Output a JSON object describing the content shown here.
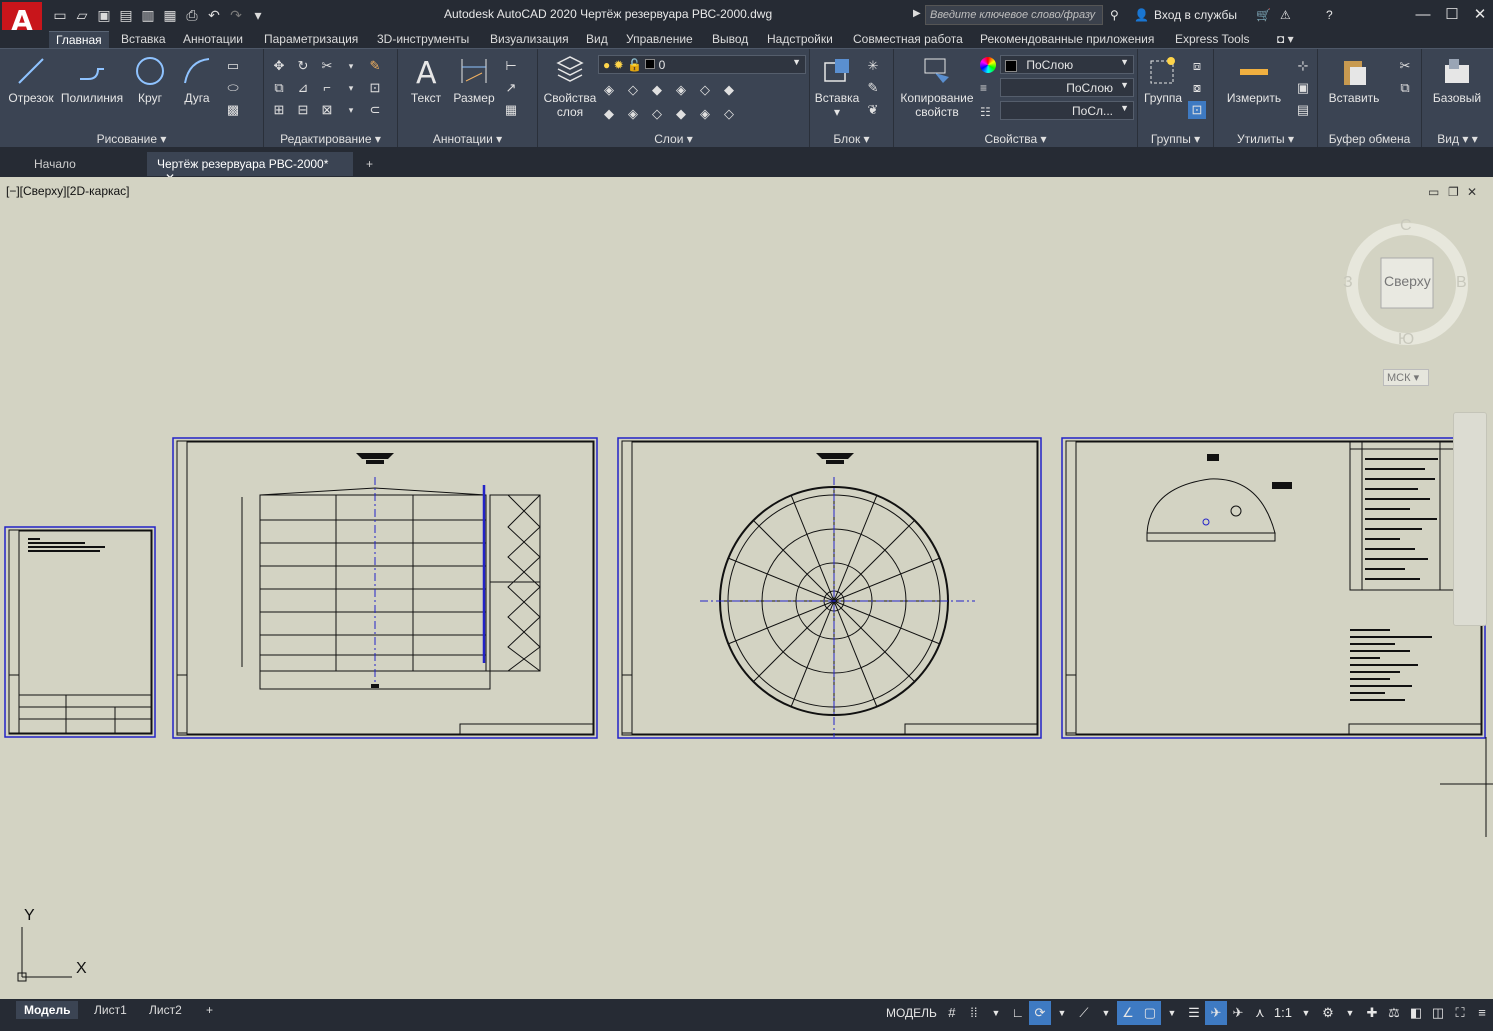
{
  "app": {
    "title": "Autodesk AutoCAD 2020    Чертёж резервуара РВС-2000.dwg",
    "logo": "A",
    "search_placeholder": "Введите ключевое слово/фразу",
    "signin": "Вход в службы"
  },
  "ribbon_tabs": [
    "Главная",
    "Вставка",
    "Аннотации",
    "Параметризация",
    "3D-инструменты",
    "Визуализация",
    "Вид",
    "Управление",
    "Вывод",
    "Надстройки",
    "Совместная работа",
    "Рекомендованные приложения",
    "Express Tools"
  ],
  "panels": {
    "draw": {
      "title": "Рисование",
      "otrezok": "Отрезок",
      "polyline": "Полилиния",
      "circle": "Круг",
      "arc": "Дуга"
    },
    "modify": {
      "title": "Редактирование"
    },
    "annotation": {
      "title": "Аннотации",
      "text": "Текст",
      "dim": "Размер"
    },
    "layers": {
      "title": "Слои",
      "layer_props_1": "Свойства",
      "layer_props_2": "слоя",
      "current_layer": "0"
    },
    "block": {
      "title": "Блок",
      "insert": "Вставка"
    },
    "properties": {
      "title": "Свойства",
      "copy1": "Копирование",
      "copy2": "свойств",
      "color": "ПоСлою",
      "linetype": "ПоСлою",
      "lineweight": "ПоСл..."
    },
    "groups": {
      "title": "Группы",
      "group": "Группа"
    },
    "utilities": {
      "title": "Утилиты",
      "measure": "Измерить"
    },
    "clipboard": {
      "title": "Буфер обмена",
      "paste": "Вставить"
    },
    "view": {
      "title": "Вид",
      "base": "Базовый"
    }
  },
  "file_tabs": {
    "start": "Начало",
    "drawing": "Чертёж резервуара РВС-2000*"
  },
  "viewport": {
    "label": "[−][Сверху][2D-каркас]",
    "viewcube": {
      "top": "Сверху",
      "n": "С",
      "s": "Ю",
      "w": "З",
      "e": "В",
      "ucs": "МСК"
    },
    "ucs_y": "Y",
    "ucs_x": "X"
  },
  "layout_tabs": [
    "Модель",
    "Лист1",
    "Лист2"
  ],
  "status": {
    "model": "МОДЕЛЬ",
    "scale": "1:1"
  },
  "colors": {
    "accent": "#3e7ac2",
    "canvas": "#d3d3c3",
    "ribbon": "#3b4453",
    "frame_border": "#2323c8"
  }
}
